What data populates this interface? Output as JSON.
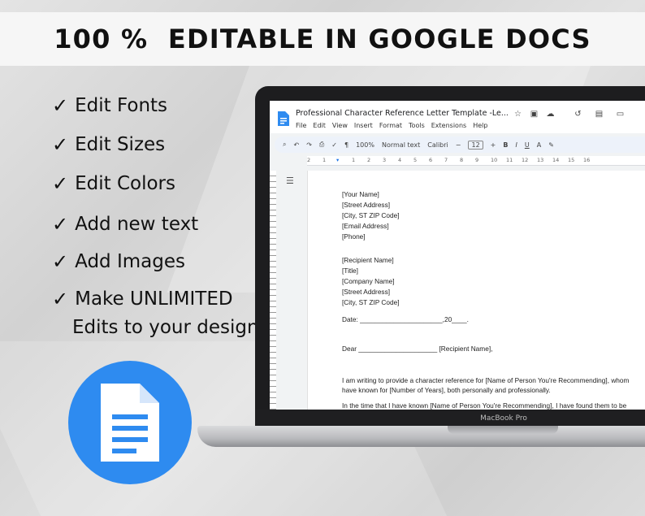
{
  "banner": {
    "text": "100 %  EDITABLE IN GOOGLE DOCS"
  },
  "features": [
    {
      "check": "✓",
      "label": "Edit Fonts"
    },
    {
      "check": "✓",
      "label": "Edit Sizes"
    },
    {
      "check": "✓",
      "label": "Edit Colors"
    },
    {
      "check": "✓",
      "label": "Add new text"
    },
    {
      "check": "✓",
      "label": "Add Images"
    },
    {
      "check": "✓",
      "label": "Make UNLIMITED"
    }
  ],
  "features_sub": "Edits to your design",
  "colors": {
    "docs_blue": "#2e8bf0",
    "laptop": "#1d1d1f"
  },
  "laptop": {
    "label": "MacBook Pro"
  },
  "docs": {
    "title": "Professional Character Reference Letter Template -Le...",
    "menu": [
      "File",
      "Edit",
      "View",
      "Insert",
      "Format",
      "Tools",
      "Extensions",
      "Help"
    ],
    "title_icons": [
      "star-icon",
      "folder-move-icon",
      "cloud-icon",
      "history-icon",
      "comment-icon",
      "video-icon"
    ],
    "toolbar": {
      "zoom": "100%",
      "style": "Normal text",
      "font": "Calibri",
      "font_size": "12",
      "bold": "B",
      "italic": "I",
      "underline": "U",
      "text_color": "A"
    },
    "ruler_numbers": [
      "2",
      "1",
      "1",
      "2",
      "3",
      "4",
      "5",
      "6",
      "7",
      "8",
      "9",
      "10",
      "11",
      "12",
      "13",
      "14",
      "15",
      "16"
    ],
    "letter": [
      "[Your Name]",
      "[Street Address]",
      "[City, ST  ZIP Code]",
      "[Email Address]",
      "[Phone]",
      "[Recipient Name]",
      "[Title]",
      "[Company Name]",
      "[Street Address]",
      "[City, ST  ZIP Code]",
      "Date: ______________________,20____.",
      "Dear _____________________ [Recipient Name],",
      "I am writing to provide a character reference for [Name of Person You're Recommending], whom",
      "have known for [Number of Years], both personally and professionally.",
      "In the time that I have known [Name of Person You're Recommending], I have found them to be"
    ]
  }
}
